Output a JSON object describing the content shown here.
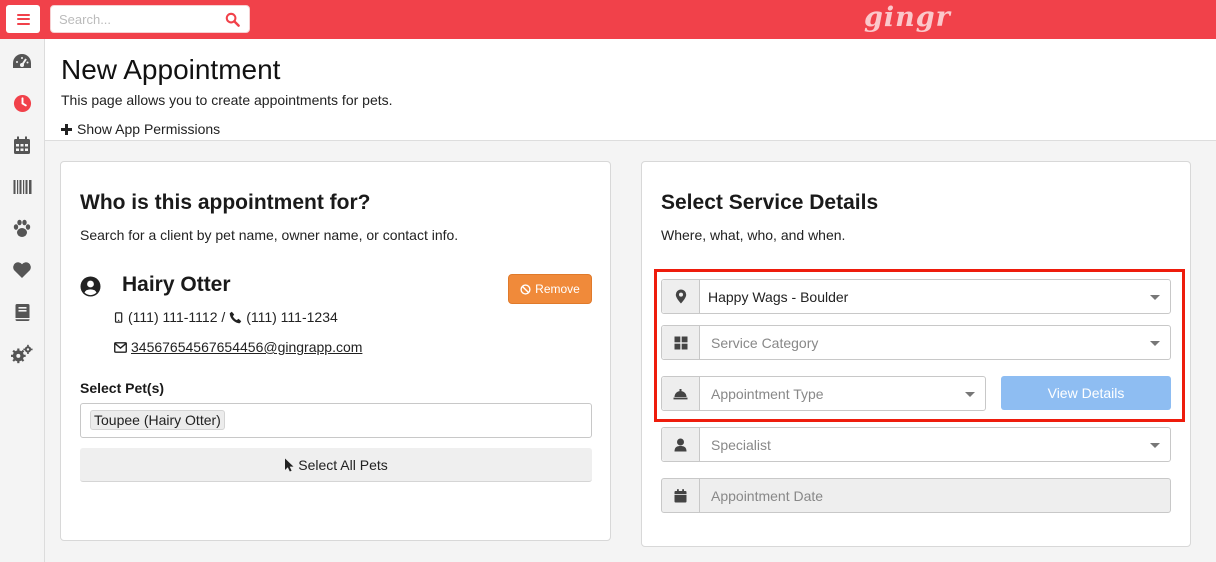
{
  "topbar": {
    "search_placeholder": "Search...",
    "logo": "gingr",
    "accent_color": "#f1414a"
  },
  "sidebar": {
    "items": [
      {
        "icon": "dashboard-icon"
      },
      {
        "icon": "clock-icon",
        "active": true
      },
      {
        "icon": "calendar-icon"
      },
      {
        "icon": "barcode-icon"
      },
      {
        "icon": "paw-icon"
      },
      {
        "icon": "heart-icon"
      },
      {
        "icon": "book-icon"
      },
      {
        "icon": "cogs-icon"
      }
    ]
  },
  "header": {
    "title": "New Appointment",
    "subtitle": "This page allows you to create appointments for pets.",
    "permissions_link": "Show App Permissions"
  },
  "client_card": {
    "title": "Who is this appointment for?",
    "subtitle": "Search for a client by pet name, owner name, or contact info.",
    "client_name": "Hairy Otter",
    "remove_label": "Remove",
    "mobile": "(111) 111-1112",
    "separator": " / ",
    "phone": "(111) 111-1234",
    "email": "34567654567654456@gingrapp.com",
    "pets_label": "Select Pet(s)",
    "selected_pet": "Toupee (Hairy Otter)",
    "select_all_label": "Select All Pets"
  },
  "service_card": {
    "title": "Select Service Details",
    "subtitle": "Where, what, who, and when.",
    "location_value": "Happy Wags - Boulder",
    "service_category_placeholder": "Service Category",
    "appointment_type_placeholder": "Appointment Type",
    "view_details_label": "View Details",
    "specialist_placeholder": "Specialist",
    "appointment_date_placeholder": "Appointment Date"
  }
}
